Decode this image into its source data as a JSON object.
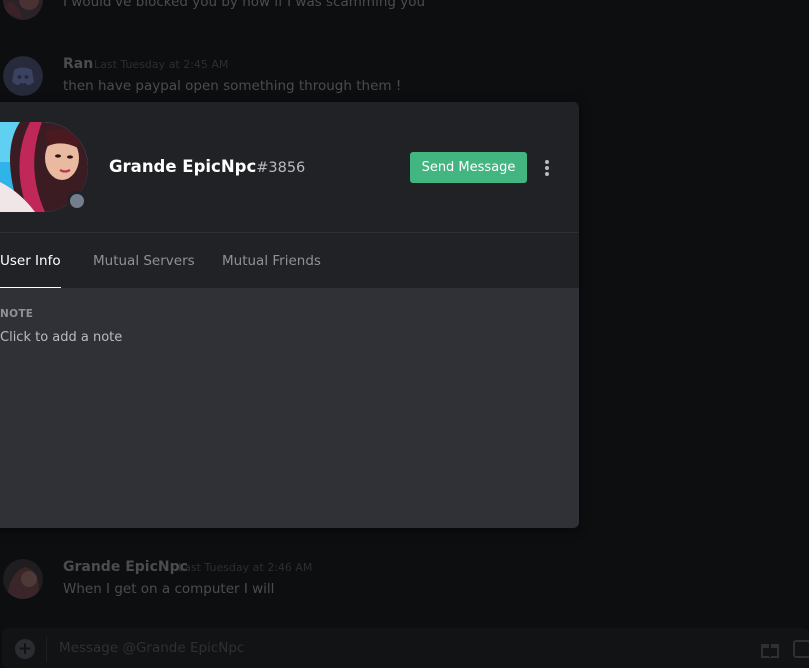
{
  "colors": {
    "backdrop": "#0d0e10",
    "modal_bg": "#2f3136",
    "modal_header_bg": "#202225",
    "send_button": "#43b581",
    "status_offline": "#747f8d"
  },
  "chat": {
    "messages": [
      {
        "author": "",
        "time": "",
        "text": "I would've blocked you by now if I was scamming you"
      },
      {
        "author": "Ran",
        "time": "Last Tuesday at 2:45 AM",
        "text": "then have paypal open something through them !"
      },
      {
        "author": "Grande EpicNpc",
        "time": "Last Tuesday at 2:46 AM",
        "text": "When I get on a computer I will"
      }
    ],
    "composer": {
      "placeholder": "Message @Grande EpicNpc",
      "icons": [
        "add-attachment-icon",
        "gift-icon",
        "gif-icon"
      ]
    }
  },
  "profile": {
    "username": "Grande EpicNpc",
    "discriminator": "#3856",
    "status": "offline",
    "send_message_label": "Send Message",
    "more_icon": "vertical-ellipsis-icon",
    "tabs": [
      {
        "label": "User Info",
        "active": true
      },
      {
        "label": "Mutual Servers",
        "active": false
      },
      {
        "label": "Mutual Friends",
        "active": false
      }
    ],
    "note_header": "NOTE",
    "note_placeholder": "Click to add a note"
  }
}
